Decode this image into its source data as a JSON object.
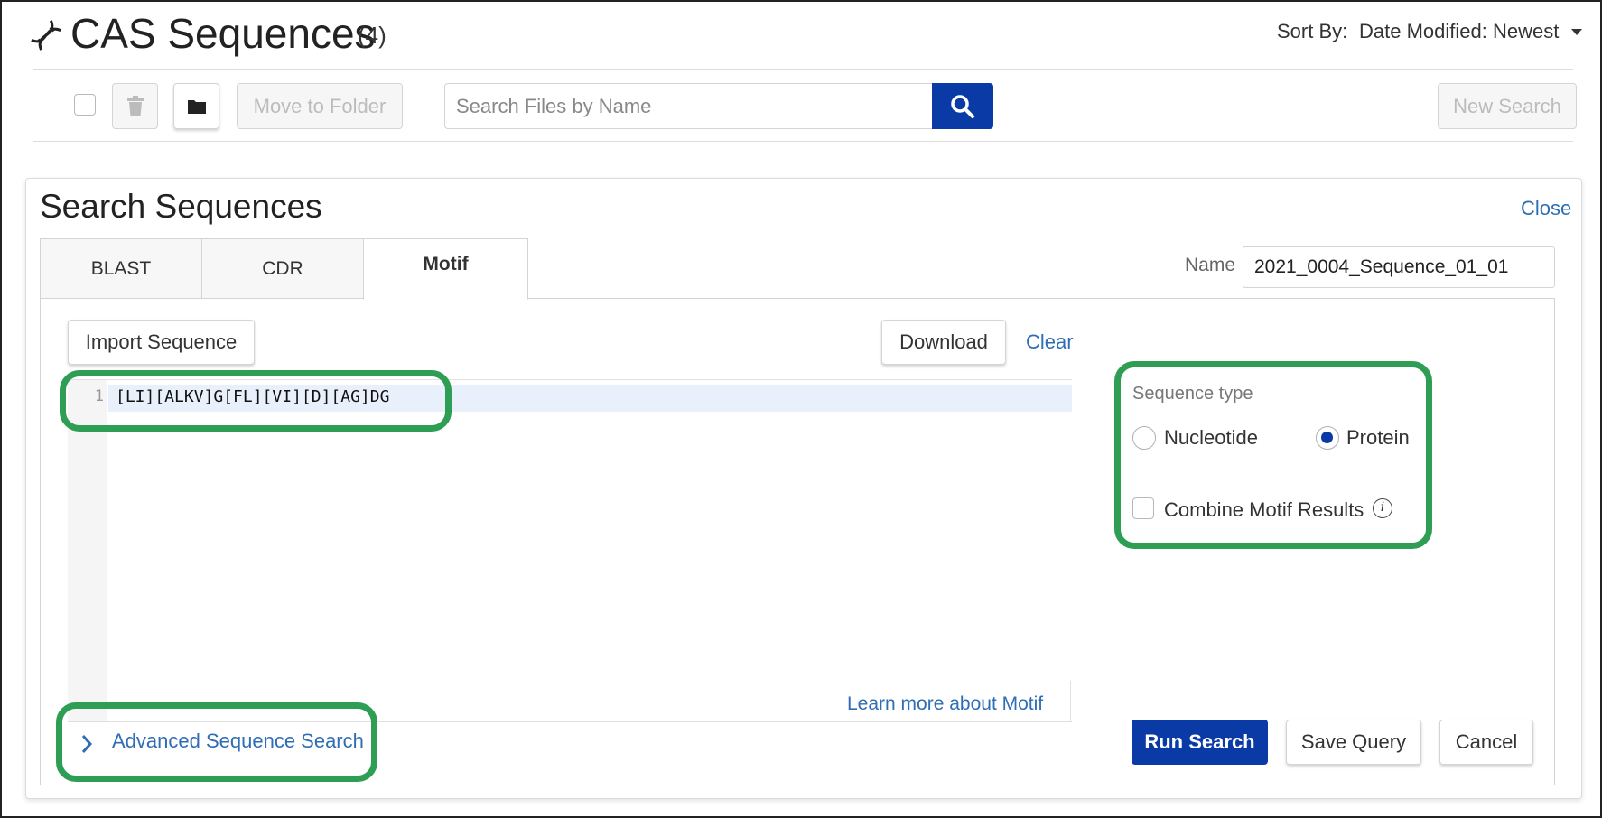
{
  "header": {
    "title": "CAS Sequences",
    "count": "(4)",
    "sort_label": "Sort By:",
    "sort_value": "Date Modified: Newest",
    "title_icon": "dna-icon"
  },
  "toolbar": {
    "move_to_folder": "Move to Folder",
    "search_placeholder": "Search Files by Name",
    "new_search": "New Search"
  },
  "panel": {
    "title": "Search Sequences",
    "close": "Close",
    "tabs": [
      {
        "label": "BLAST",
        "active": false
      },
      {
        "label": "CDR",
        "active": false
      },
      {
        "label": "Motif",
        "active": true
      }
    ],
    "name_label": "Name",
    "name_value": "2021_0004_Sequence_01_01",
    "import_sequence": "Import Sequence",
    "download": "Download",
    "clear": "Clear",
    "editor": {
      "line_number": "1",
      "code": "[LI][ALKV]G[FL][VI][D][AG]DG"
    },
    "learn_more": "Learn more about Motif",
    "sequence_type_label": "Sequence type",
    "nucleotide": "Nucleotide",
    "protein": "Protein",
    "selected_type": "Protein",
    "combine_motif": "Combine Motif Results",
    "combine_checked": false,
    "advanced_search": "Advanced Sequence Search",
    "run_search": "Run Search",
    "save_query": "Save Query",
    "cancel": "Cancel"
  },
  "colors": {
    "primary": "#0a3aa6",
    "link": "#2f6db5",
    "highlight": "#2e9e55"
  }
}
